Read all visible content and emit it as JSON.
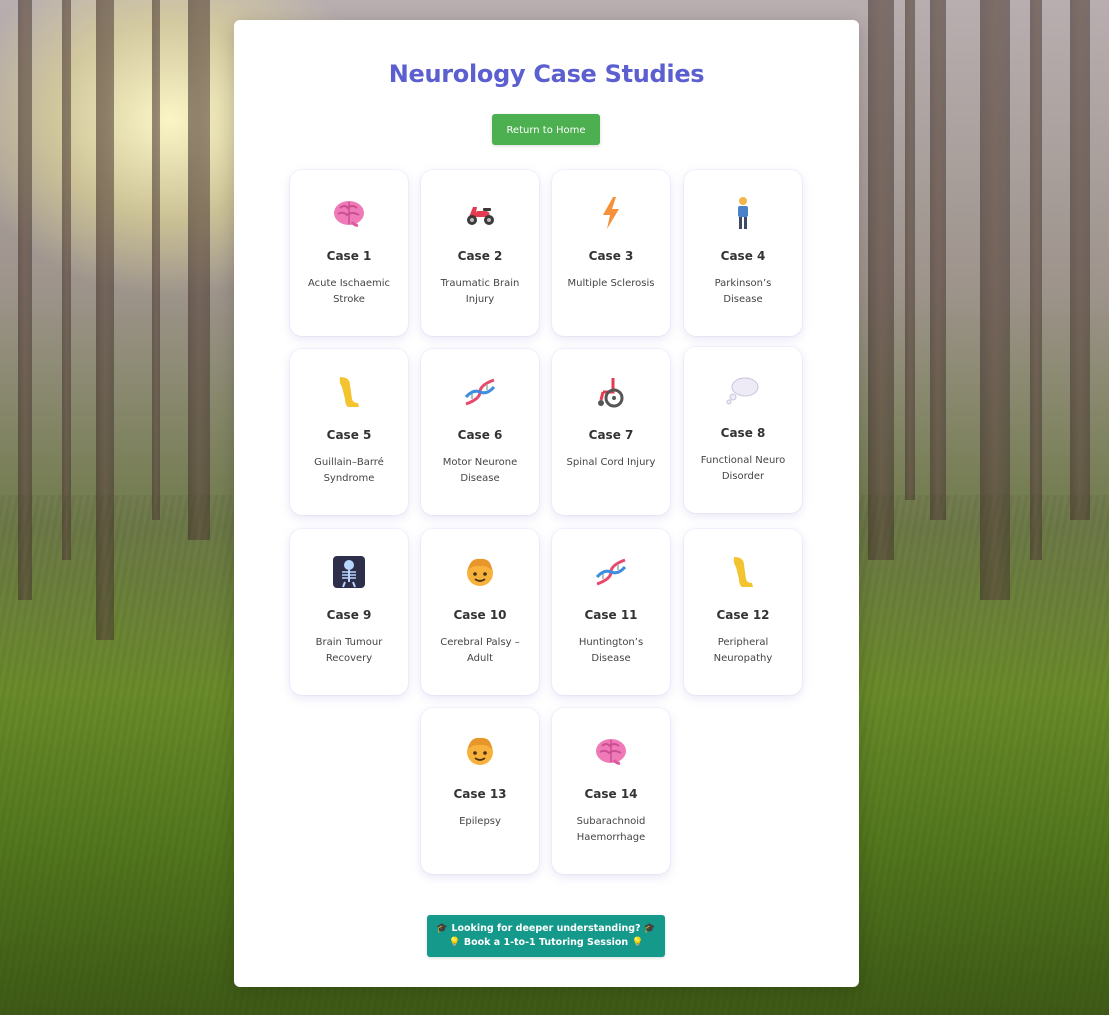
{
  "page": {
    "title": "Neurology Case Studies",
    "home_button": "Return to Home"
  },
  "cases": [
    {
      "title": "Case 1",
      "subtitle": "Acute Ischaemic Stroke",
      "icon": "brain-icon"
    },
    {
      "title": "Case 2",
      "subtitle": "Traumatic Brain Injury",
      "icon": "motor-scooter-icon"
    },
    {
      "title": "Case 3",
      "subtitle": "Multiple Sclerosis",
      "icon": "lightning-icon"
    },
    {
      "title": "Case 4",
      "subtitle": "Parkinson’s Disease",
      "icon": "standing-person-icon"
    },
    {
      "title": "Case 5",
      "subtitle": "Guillain–Barré Syndrome",
      "icon": "leg-icon"
    },
    {
      "title": "Case 6",
      "subtitle": "Motor Neurone Disease",
      "icon": "dna-icon"
    },
    {
      "title": "Case 7",
      "subtitle": "Spinal Cord Injury",
      "icon": "wheelchair-icon"
    },
    {
      "title": "Case 8",
      "subtitle": "Functional Neuro Disorder",
      "icon": "thought-bubble-icon"
    },
    {
      "title": "Case 9",
      "subtitle": "Brain Tumour Recovery",
      "icon": "x-ray-icon"
    },
    {
      "title": "Case 10",
      "subtitle": "Cerebral Palsy – Adult",
      "icon": "child-face-icon"
    },
    {
      "title": "Case 11",
      "subtitle": "Huntington’s Disease",
      "icon": "dna-icon"
    },
    {
      "title": "Case 12",
      "subtitle": "Peripheral Neuropathy",
      "icon": "leg-icon"
    },
    {
      "title": "Case 13",
      "subtitle": "Epilepsy",
      "icon": "child-face-icon"
    },
    {
      "title": "Case 14",
      "subtitle": "Subarachnoid Haemorrhage",
      "icon": "brain-icon"
    }
  ],
  "tutoring": {
    "line1": "🎓 Looking for deeper understanding? 🎓",
    "line2": "💡 Book a 1-to-1 Tutoring Session 💡"
  },
  "colors": {
    "title": "#5b5fcf",
    "home_button": "#4caf50",
    "tutor_button": "#14998a"
  }
}
